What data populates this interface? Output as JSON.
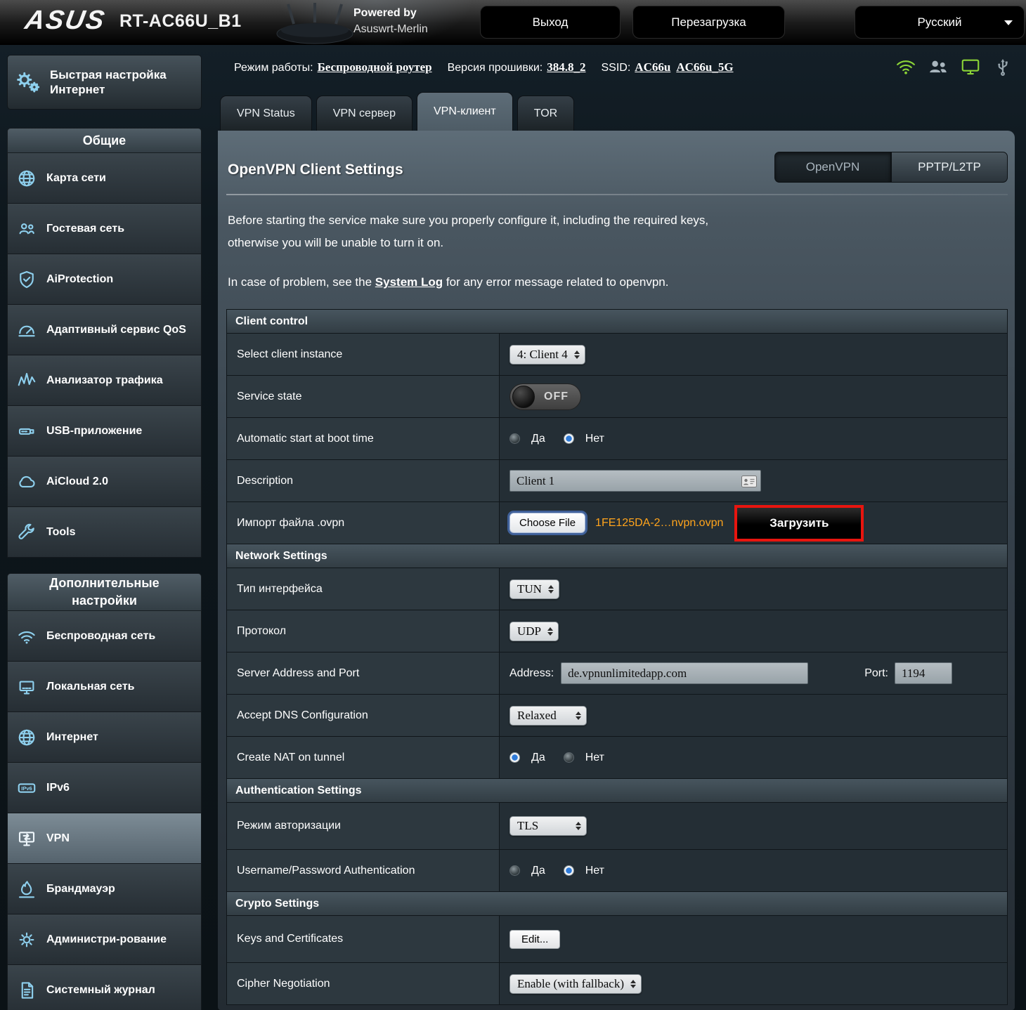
{
  "colors": {
    "file_orange": "#ffa41c",
    "annotation_red": "#e8150f",
    "icon_blue": "#8ed0ee",
    "status_green": "#8bd437"
  },
  "topbar": {
    "brand": "ASUS",
    "model": "RT-AC66U_B1",
    "powered_line1": "Powered by",
    "powered_line2": "Asuswrt-Merlin",
    "logout": "Выход",
    "reboot": "Перезагрузка",
    "language": "Русский"
  },
  "infobar": {
    "mode_label": "Режим работы:",
    "mode_value": "Беспроводной роутер",
    "fw_label": "Версия прошивки:",
    "fw_value": "384.8_2",
    "ssid_label": "SSID:",
    "ssid_main": "AC66u",
    "ssid_5g": "AC66u_5G"
  },
  "sidebar": {
    "quick_setup": "Быстрая настройка Интернет",
    "general_header": "Общие",
    "general_items": [
      {
        "label": "Карта сети"
      },
      {
        "label": "Гостевая сеть"
      },
      {
        "label": "AiProtection"
      },
      {
        "label": "Адаптивный сервис QoS"
      },
      {
        "label": "Анализатор трафика"
      },
      {
        "label": "USB-приложение"
      },
      {
        "label": "AiCloud 2.0"
      },
      {
        "label": "Tools"
      }
    ],
    "advanced_header": "Дополнительные настройки",
    "advanced_items": [
      {
        "label": "Беспроводная сеть"
      },
      {
        "label": "Локальная сеть"
      },
      {
        "label": "Интернет"
      },
      {
        "label": "IPv6"
      },
      {
        "label": "VPN"
      },
      {
        "label": "Брандмауэр"
      },
      {
        "label": "Администри-рование"
      },
      {
        "label": "Системный журнал"
      }
    ]
  },
  "tabs": [
    {
      "label": "VPN Status"
    },
    {
      "label": "VPN сервер"
    },
    {
      "label": "VPN-клиент"
    },
    {
      "label": "TOR"
    }
  ],
  "content": {
    "title": "OpenVPN Client Settings",
    "toggle_openvpn": "OpenVPN",
    "toggle_pptp": "PPTP/L2TP",
    "intro_line1": "Before starting the service make sure you properly configure it, including the required keys,",
    "intro_line2": "otherwise you will be unable to turn it on.",
    "problem_pre": "In case of problem, see the",
    "problem_link": "System Log",
    "problem_post": "for any error message related to openvpn.",
    "yes": "Да",
    "no": "Нет",
    "client_control": {
      "header": "Client control",
      "select_label": "Select client instance",
      "select_value": "4: Client 4",
      "service_label": "Service state",
      "service_value": "OFF",
      "autostart_label": "Automatic start at boot time",
      "description_label": "Description",
      "description_value": "Client 1",
      "import_label": "Импорт файла .ovpn",
      "choose_file": "Choose File",
      "file_name": "1FE125DA-2…nvpn.ovpn",
      "upload": "Загрузить"
    },
    "network": {
      "header": "Network Settings",
      "iface_label": "Тип интерфейса",
      "iface_value": "TUN",
      "proto_label": "Протокол",
      "proto_value": "UDP",
      "server_label": "Server Address and Port",
      "address_label": "Address:",
      "address_value": "de.vpnunlimitedapp.com",
      "port_label": "Port:",
      "port_value": "1194",
      "dns_label": "Accept DNS Configuration",
      "dns_value": "Relaxed",
      "nat_label": "Create NAT on tunnel"
    },
    "auth": {
      "header": "Authentication Settings",
      "mode_label": "Режим авторизации",
      "mode_value": "TLS",
      "userpass_label": "Username/Password Authentication"
    },
    "crypto": {
      "header": "Crypto Settings",
      "keys_label": "Keys and Certificates",
      "edit": "Edit...",
      "cipher_label": "Cipher Negotiation",
      "cipher_value": "Enable (with fallback)"
    }
  }
}
